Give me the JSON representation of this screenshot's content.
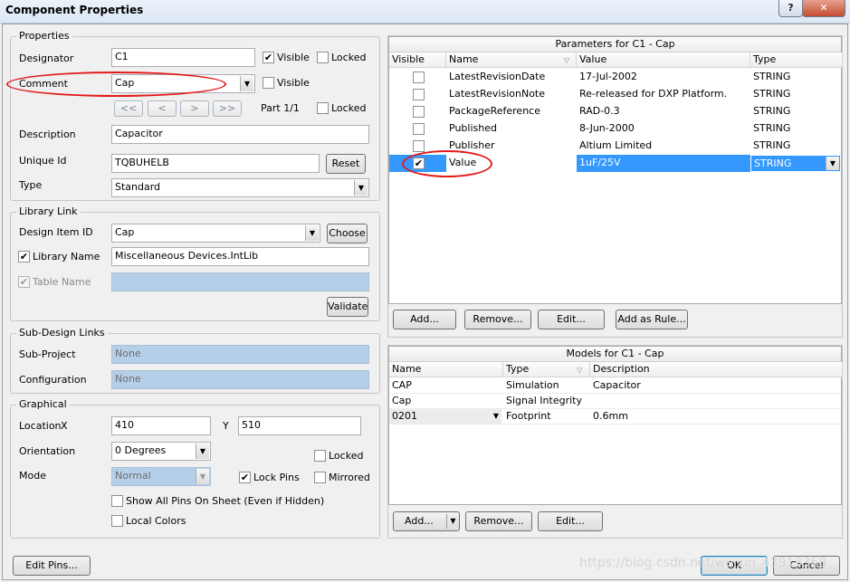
{
  "window": {
    "title": "Component Properties",
    "help": "?",
    "close": "✕"
  },
  "properties": {
    "group_title": "Properties",
    "designator_label": "Designator",
    "designator_value": "C1",
    "visible_label": "Visible",
    "locked_label": "Locked",
    "comment_label": "Comment",
    "comment_value": "Cap",
    "comment_visible_label": "Visible",
    "nav_buttons": [
      "<<",
      "<",
      ">",
      ">>"
    ],
    "part_label": "Part 1/1",
    "part_locked_label": "Locked",
    "description_label": "Description",
    "description_value": "Capacitor",
    "unique_id_label": "Unique Id",
    "unique_id_value": "TQBUHELB",
    "reset_label": "Reset",
    "type_label": "Type",
    "type_value": "Standard"
  },
  "library_link": {
    "group_title": "Library Link",
    "design_item_label": "Design Item ID",
    "design_item_value": "Cap",
    "choose_label": "Choose",
    "library_name_label": "Library Name",
    "library_name_value": "Miscellaneous Devices.IntLib",
    "table_name_label": "Table Name",
    "validate_label": "Validate"
  },
  "sub_design": {
    "group_title": "Sub-Design Links",
    "sub_project_label": "Sub-Project",
    "sub_project_value": "None",
    "configuration_label": "Configuration",
    "configuration_value": "None"
  },
  "graphical": {
    "group_title": "Graphical",
    "location_label": "Location",
    "x_label": "X",
    "x_value": "410",
    "y_label": "Y",
    "y_value": "510",
    "orientation_label": "Orientation",
    "orientation_value": "0 Degrees",
    "locked_label": "Locked",
    "mode_label": "Mode",
    "mode_value": "Normal",
    "lock_pins_label": "Lock Pins",
    "mirrored_label": "Mirrored",
    "show_all_pins_label": "Show All Pins On Sheet (Even if Hidden)",
    "local_colors_label": "Local Colors"
  },
  "parameters": {
    "caption": "Parameters for C1 - Cap",
    "columns": [
      "Visible",
      "Name",
      "Value",
      "Type"
    ],
    "rows": [
      {
        "visible": false,
        "name": "LatestRevisionDate",
        "value": "17-Jul-2002",
        "type": "STRING"
      },
      {
        "visible": false,
        "name": "LatestRevisionNote",
        "value": "Re-released for DXP Platform.",
        "type": "STRING"
      },
      {
        "visible": false,
        "name": "PackageReference",
        "value": "RAD-0.3",
        "type": "STRING"
      },
      {
        "visible": false,
        "name": "Published",
        "value": "8-Jun-2000",
        "type": "STRING"
      },
      {
        "visible": false,
        "name": "Publisher",
        "value": "Altium Limited",
        "type": "STRING"
      },
      {
        "visible": true,
        "name": "Value",
        "value": "1uF/25V",
        "type": "STRING"
      }
    ],
    "buttons": [
      "Add...",
      "Remove...",
      "Edit...",
      "Add as Rule..."
    ]
  },
  "models": {
    "caption": "Models for C1 - Cap",
    "columns": [
      "Name",
      "Type",
      "Description"
    ],
    "rows": [
      {
        "name": "CAP",
        "type": "Simulation",
        "description": "Capacitor"
      },
      {
        "name": "Cap",
        "type": "Signal Integrity",
        "description": ""
      },
      {
        "name": "0201",
        "type": "Footprint",
        "description": "0.6mm"
      }
    ],
    "buttons": [
      "Add...",
      "Remove...",
      "Edit..."
    ]
  },
  "footer": {
    "edit_pins_label": "Edit Pins...",
    "ok_label": "OK",
    "cancel_label": "Cancel",
    "watermark": "https://blog.csdn.net/weixin_43913368"
  },
  "colors": {
    "selection": "#3399ff",
    "annotation": "#e11b1b",
    "disabled_field": "#b6cfe8"
  }
}
